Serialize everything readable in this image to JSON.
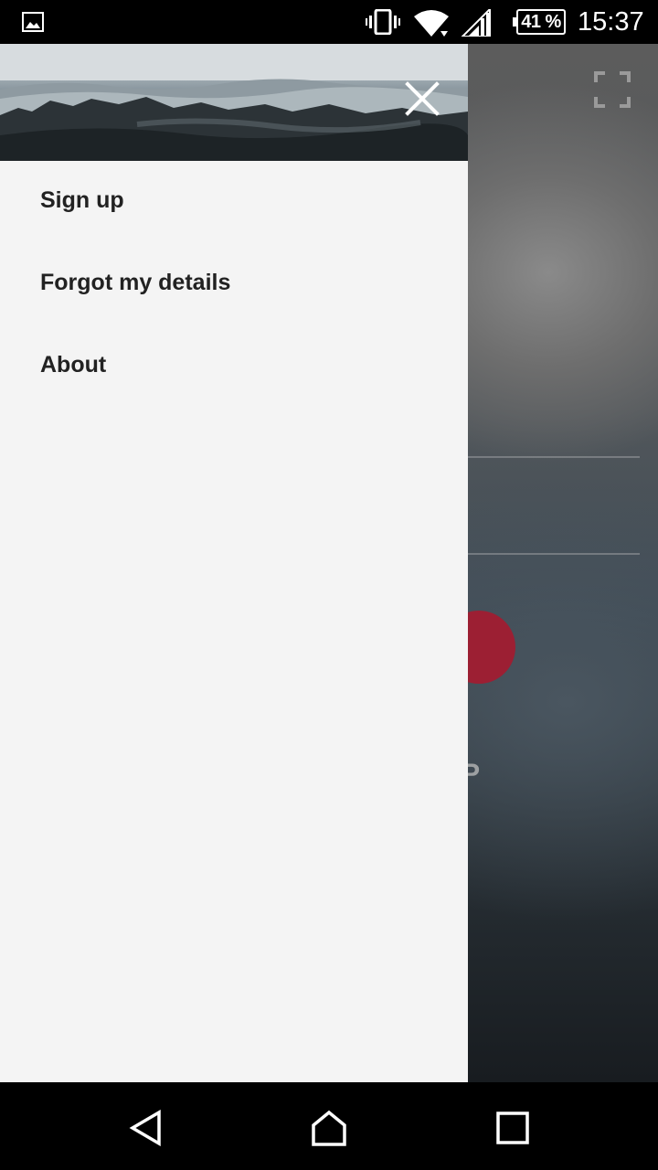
{
  "status_bar": {
    "battery": "41 %",
    "time": "15:37"
  },
  "background_app": {
    "signup_partial": "N UP"
  },
  "drawer": {
    "menu": [
      {
        "label": "Sign up"
      },
      {
        "label": "Forgot my details"
      },
      {
        "label": "About"
      }
    ]
  },
  "colors": {
    "drawer_bg": "#f4f4f4",
    "menu_text": "#222222",
    "accent_red": "#9c1f33"
  },
  "icons": {
    "status": [
      "gallery-icon",
      "vibrate-icon",
      "wifi-icon",
      "signal-icon",
      "battery-icon"
    ],
    "drawer": [
      "close-icon"
    ],
    "background": [
      "fullscreen-icon"
    ],
    "nav": [
      "back-icon",
      "home-icon",
      "recents-icon"
    ]
  }
}
